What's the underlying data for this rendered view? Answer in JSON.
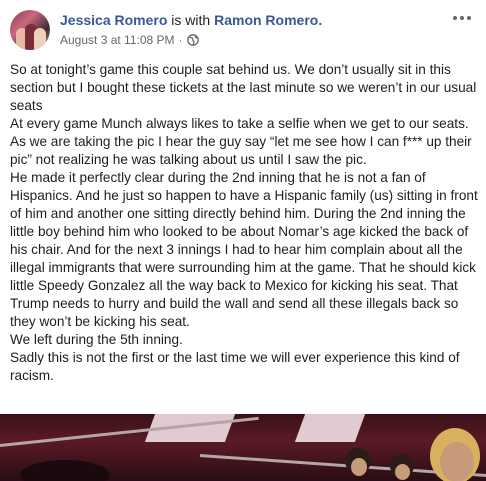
{
  "post": {
    "author": "Jessica Romero",
    "with_text": "is with",
    "tagged": "Ramon Romero.",
    "timestamp": "August 3 at 11:08 PM",
    "separator": "·",
    "privacy_icon": "globe-icon",
    "more_icon": "more-options-icon",
    "body": [
      "So at tonight’s game this couple sat behind us. We don’t usually sit in this section but I bought these tickets at the last minute so we weren’t in our usual seats",
      "At every game Munch always likes to take a selfie when we get to our seats. As we are taking the pic I hear the guy say “let me see how I can f*** up their pic” not realizing he was talking about us until I saw the pic.",
      "He made it perfectly clear during the 2nd inning that he is not a fan of Hispanics. And he just so happen to have a Hispanic family (us) sitting in front of him and another one sitting directly behind him. During the 2nd inning the little boy behind him who looked to be about Nomar’s age kicked the back of his chair. And for the next 3 innings I had to hear him complain about all the illegal immigrants that were surrounding him at the game. That he should kick little Speedy Gonzalez all the way back to Mexico for kicking his seat. That Trump needs to hurry and build the wall and send all these illegals back so they won’t be kicking his seat.",
      "We left during the 5th inning.",
      "Sadly this is not the first or the last time we will ever experience this kind of racism."
    ]
  },
  "colors": {
    "link": "#385898",
    "meta": "#616770",
    "text": "#1c1e21"
  }
}
